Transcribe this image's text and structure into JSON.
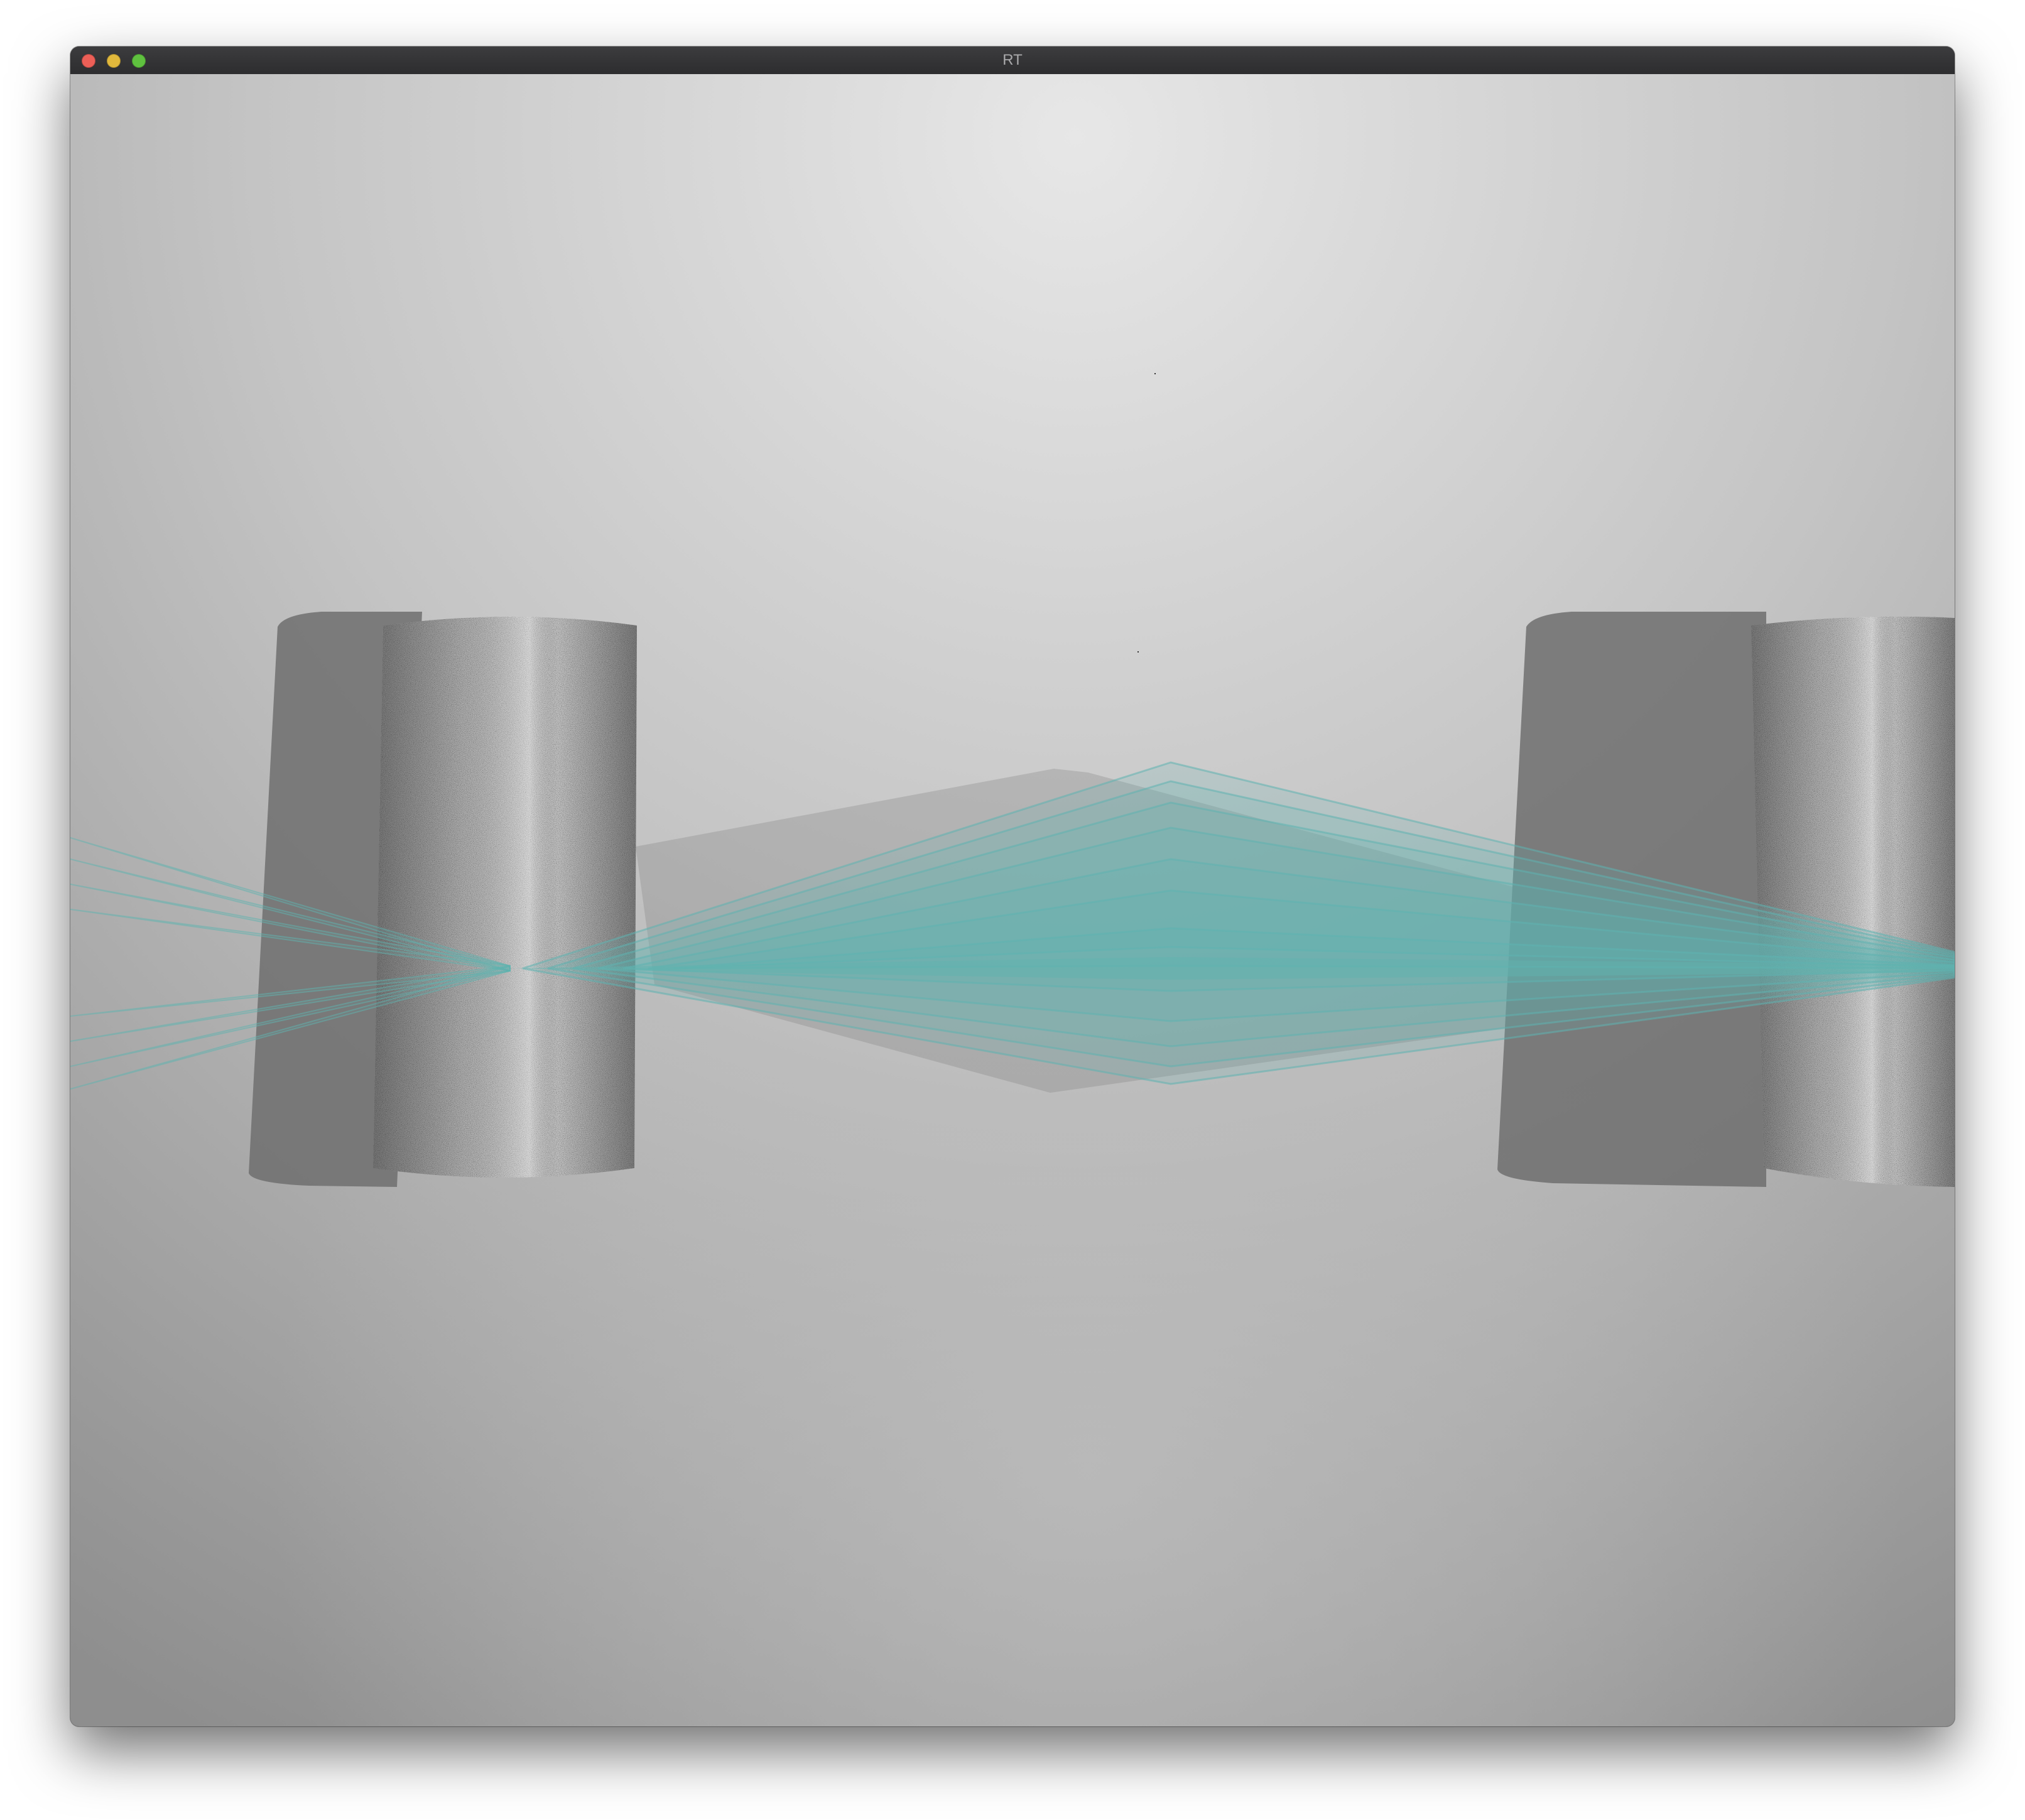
{
  "window": {
    "title": "RT",
    "controls": {
      "close_color": "#ec5f57",
      "minimize_color": "#e1b83c",
      "maximize_color": "#5fc13f"
    }
  },
  "scene": {
    "background_light": "#e6e6e6",
    "background_dark": "#878787",
    "beam_color": "#5fb3b0",
    "cylinder_texture": "noise-gray",
    "shadow_color": "#6f6f6f",
    "objects": [
      "cylinder-left",
      "cylinder-right",
      "light-beam-fan"
    ]
  }
}
